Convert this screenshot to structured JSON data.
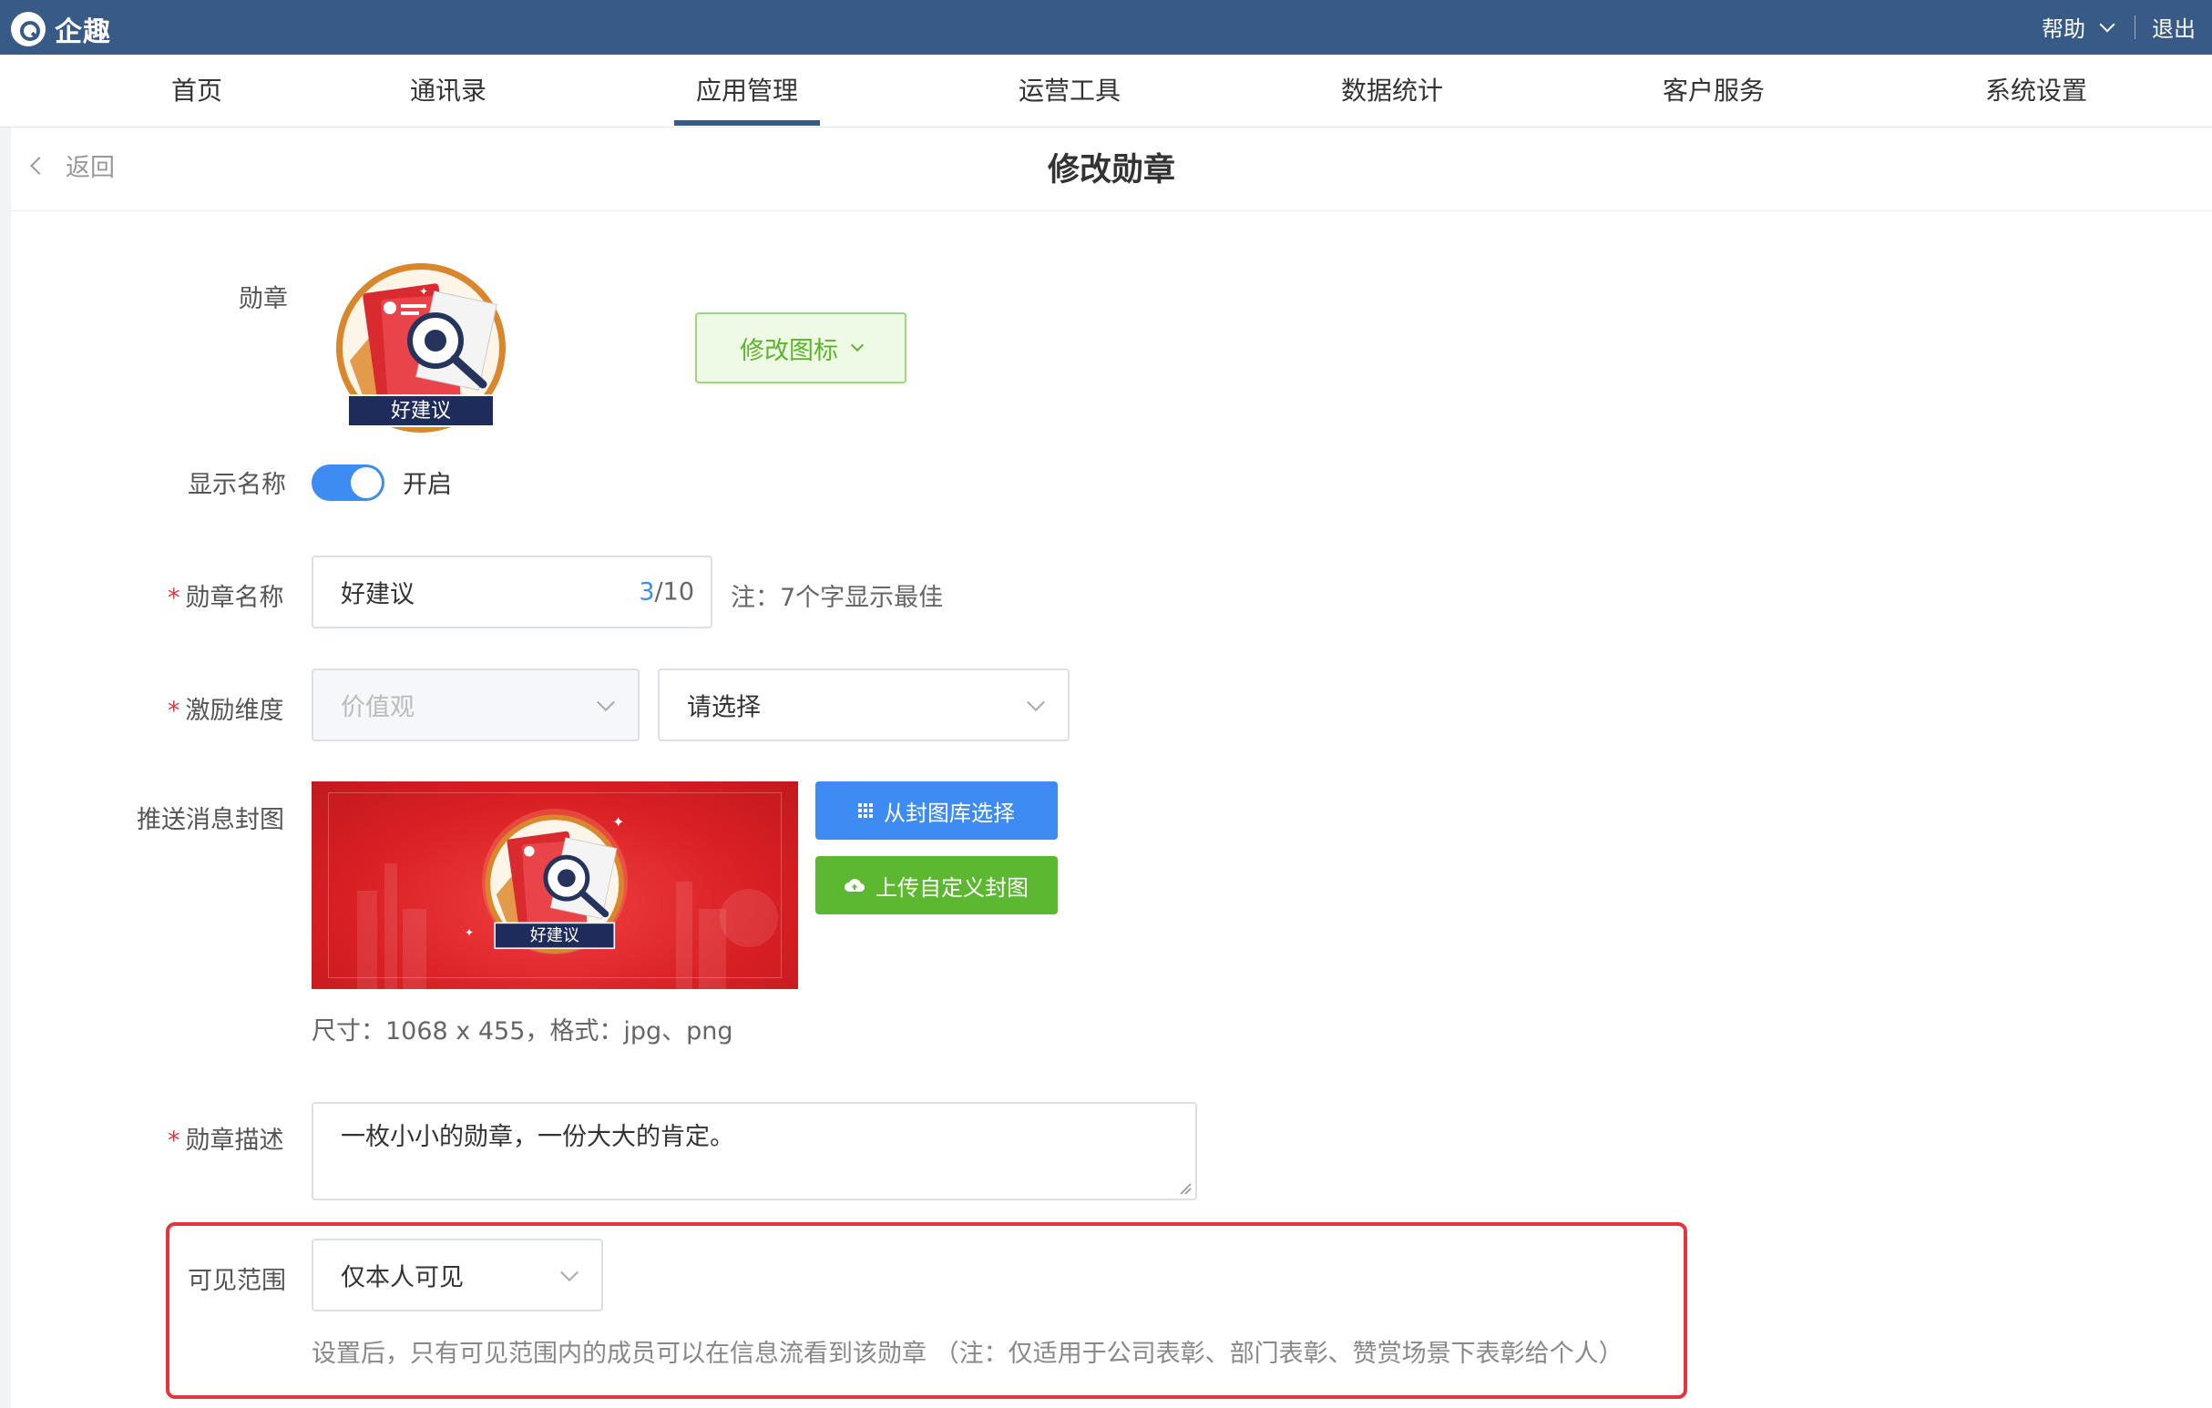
{
  "app": {
    "name": "企趣",
    "help_label": "帮助",
    "logout_label": "退出"
  },
  "nav": {
    "items": [
      {
        "label": "首页"
      },
      {
        "label": "通讯录"
      },
      {
        "label": "应用管理"
      },
      {
        "label": "运营工具"
      },
      {
        "label": "数据统计"
      },
      {
        "label": "客户服务"
      },
      {
        "label": "系统设置"
      }
    ],
    "active_index": 2
  },
  "page": {
    "back_label": "返回",
    "title": "修改勋章"
  },
  "form": {
    "badge_label": "勋章",
    "badge_caption": "好建议",
    "modify_icon_button": "修改图标",
    "show_name_label": "显示名称",
    "show_name_toggle": "开启",
    "show_name_enabled": true,
    "name_label": "勋章名称",
    "name_value": "好建议",
    "name_count_current": "3",
    "name_count_max": "/10",
    "name_note": "注：7个字显示最佳",
    "dimension_label": "激励维度",
    "dimension_primary": "价值观",
    "dimension_secondary_placeholder": "请选择",
    "cover_label": "推送消息封图",
    "cover_caption": "好建议",
    "cover_library_button": "从封图库选择",
    "cover_upload_button": "上传自定义封图",
    "cover_size_note": "尺寸：1068 x 455，格式：jpg、png",
    "desc_label": "勋章描述",
    "desc_value": "一枚小小的勋章，一份大大的肯定。",
    "visibility_label": "可见范围",
    "visibility_value": "仅本人可见",
    "visibility_note": "设置后，只有可见范围内的成员可以在信息流看到该勋章 （注：仅适用于公司表彰、部门表彰、赞赏场景下表彰给个人）"
  },
  "colors": {
    "topbar": "#385a86",
    "accent_blue": "#3d8bf3",
    "accent_green": "#5cb830",
    "badge_red": "#d91f24",
    "highlight_red": "#e5343a"
  }
}
